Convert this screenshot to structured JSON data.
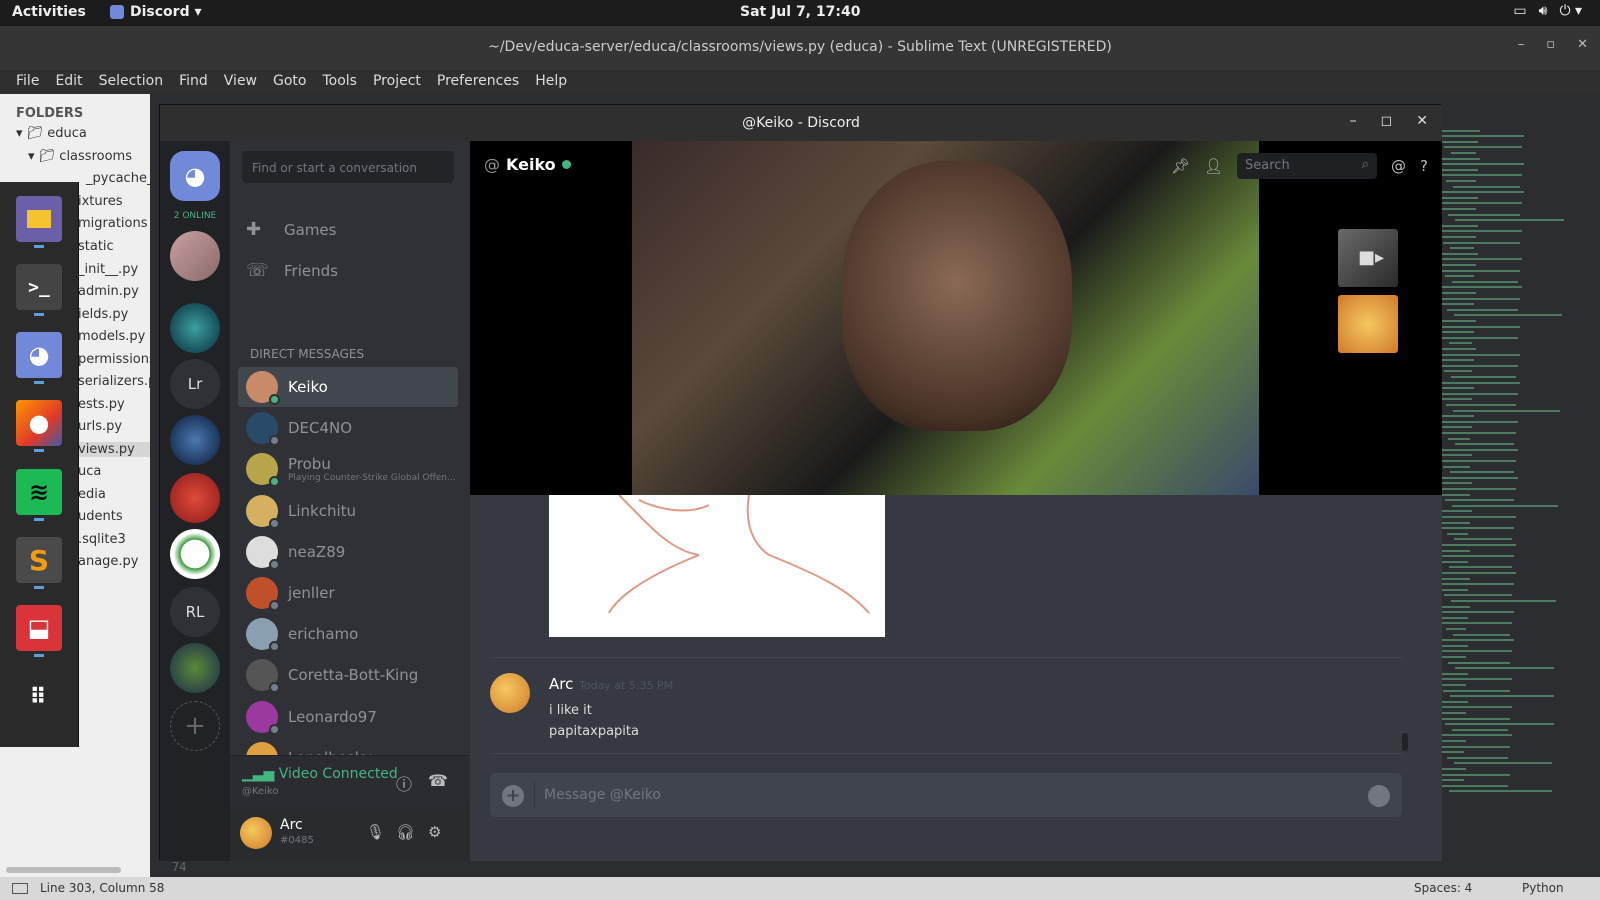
{
  "topbar": {
    "activities": "Activities",
    "app": "Discord ▾",
    "clock": "Sat Jul  7, 17:40"
  },
  "sublime": {
    "title": "~/Dev/educa-server/educa/classrooms/views.py (educa) - Sublime Text (UNREGISTERED)",
    "menu": [
      "File",
      "Edit",
      "Selection",
      "Find",
      "View",
      "Goto",
      "Tools",
      "Project",
      "Preferences",
      "Help"
    ],
    "folders_header": "FOLDERS",
    "tree": [
      "educa",
      "classrooms",
      "_pycache_",
      "ixtures",
      "migrations",
      "static",
      "_init__.py",
      "admin.py",
      "ields.py",
      "models.py",
      "permissions.",
      "serializers.py",
      "ests.py",
      "urls.py",
      "views.py",
      "uca",
      "edia",
      "udents",
      ".sqlite3",
      "anage.py"
    ],
    "status_left": "Line 303, Column 58",
    "status_spaces": "Spaces: 4",
    "status_lang": "Python",
    "gutter_num": "74"
  },
  "discord": {
    "window_title": "@Keiko - Discord",
    "online_count": "2 ONLINE",
    "search_placeholder": "Find or start a conversation",
    "nav": {
      "games": "Games",
      "friends": "Friends"
    },
    "dm_header": "DIRECT MESSAGES",
    "guild_initials": [
      "Lr",
      "RL"
    ],
    "dms": [
      {
        "name": "Keiko",
        "sub": "",
        "color": "#c98a6a",
        "online": true,
        "active": true
      },
      {
        "name": "DEC4NO",
        "sub": "",
        "color": "#2a4a6a",
        "online": false,
        "active": false
      },
      {
        "name": "Probu",
        "sub": "Playing Counter-Strike Global Offen...",
        "color": "#b8a44a",
        "online": true,
        "active": false
      },
      {
        "name": "Linkchitu",
        "sub": "",
        "color": "#d4b060",
        "online": false,
        "active": false
      },
      {
        "name": "neaZ89",
        "sub": "",
        "color": "#dddddd",
        "online": false,
        "active": false
      },
      {
        "name": "jenller",
        "sub": "",
        "color": "#c0502a",
        "online": false,
        "active": false
      },
      {
        "name": "erichamo",
        "sub": "",
        "color": "#8aa0b0",
        "online": false,
        "active": false
      },
      {
        "name": "Coretta-Bott-King",
        "sub": "",
        "color": "#555555",
        "online": false,
        "active": false
      },
      {
        "name": "Leonardo97",
        "sub": "",
        "color": "#9a3aa0",
        "online": false,
        "active": false
      },
      {
        "name": "Lepalbosky",
        "sub": "",
        "color": "#e0a040",
        "online": false,
        "active": false
      }
    ],
    "voice": {
      "status": "Video Connected",
      "target": "@Keiko"
    },
    "user": {
      "name": "Arc",
      "tag": "#0485"
    },
    "channel": {
      "at": "@",
      "name": "Keiko"
    },
    "search": "Search",
    "message": {
      "author": "Arc",
      "time": "Today at 5:35 PM",
      "lines": [
        "i like it",
        "papitaxpapita"
      ]
    },
    "composer_placeholder": "Message @Keiko"
  },
  "colors": {
    "accent": "#7289da",
    "online": "#43b581",
    "bg": "#36393f"
  }
}
